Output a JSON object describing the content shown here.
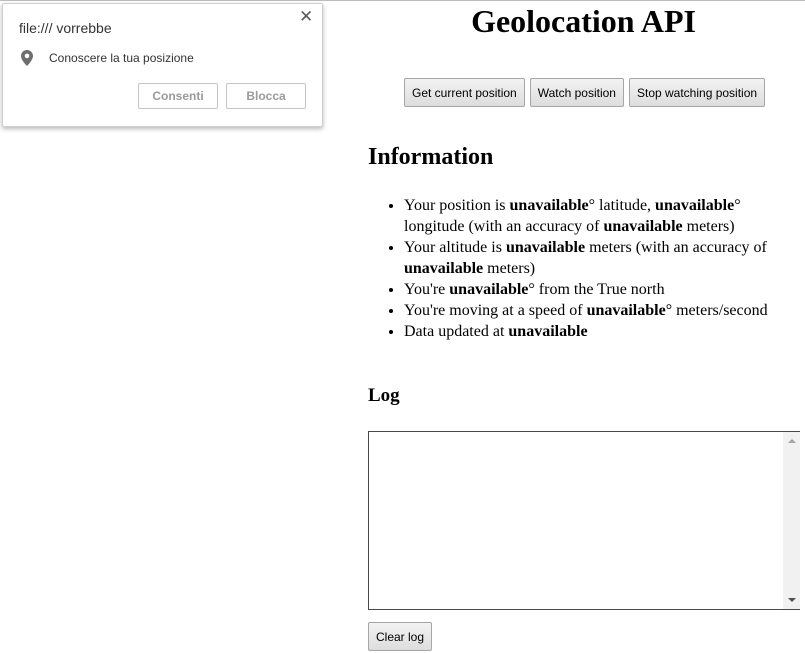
{
  "permission_popup": {
    "title": "file:/// vorrebbe",
    "request_label": "Conoscere la tua posizione",
    "close_symbol": "✕",
    "allow_label": "Consenti",
    "block_label": "Blocca",
    "pin_icon": "location-pin-icon"
  },
  "page": {
    "title": "Geolocation API",
    "buttons": {
      "get_current": "Get current position",
      "watch": "Watch position",
      "stop_watching": "Stop watching position"
    },
    "information": {
      "heading": "Information",
      "items": [
        {
          "text_1": "Your position is ",
          "value_1": "unavailable",
          "text_2": "° latitude, ",
          "value_2": "unavailable",
          "text_3": "° longitude (with an accuracy of ",
          "value_3": "unavailable",
          "text_4": " meters)"
        },
        {
          "text_1": "Your altitude is ",
          "value_1": "unavailable",
          "text_2": " meters (with an accuracy of ",
          "value_2": "unavailable",
          "text_3": " meters)"
        },
        {
          "text_1": "You're ",
          "value_1": "unavailable",
          "text_2": "° from the True north"
        },
        {
          "text_1": "You're moving at a speed of ",
          "value_1": "unavailable",
          "text_2": "° meters/second"
        },
        {
          "text_1": "Data updated at ",
          "value_1": "unavailable"
        }
      ]
    },
    "log": {
      "heading": "Log",
      "content": "",
      "clear_label": "Clear log"
    }
  }
}
